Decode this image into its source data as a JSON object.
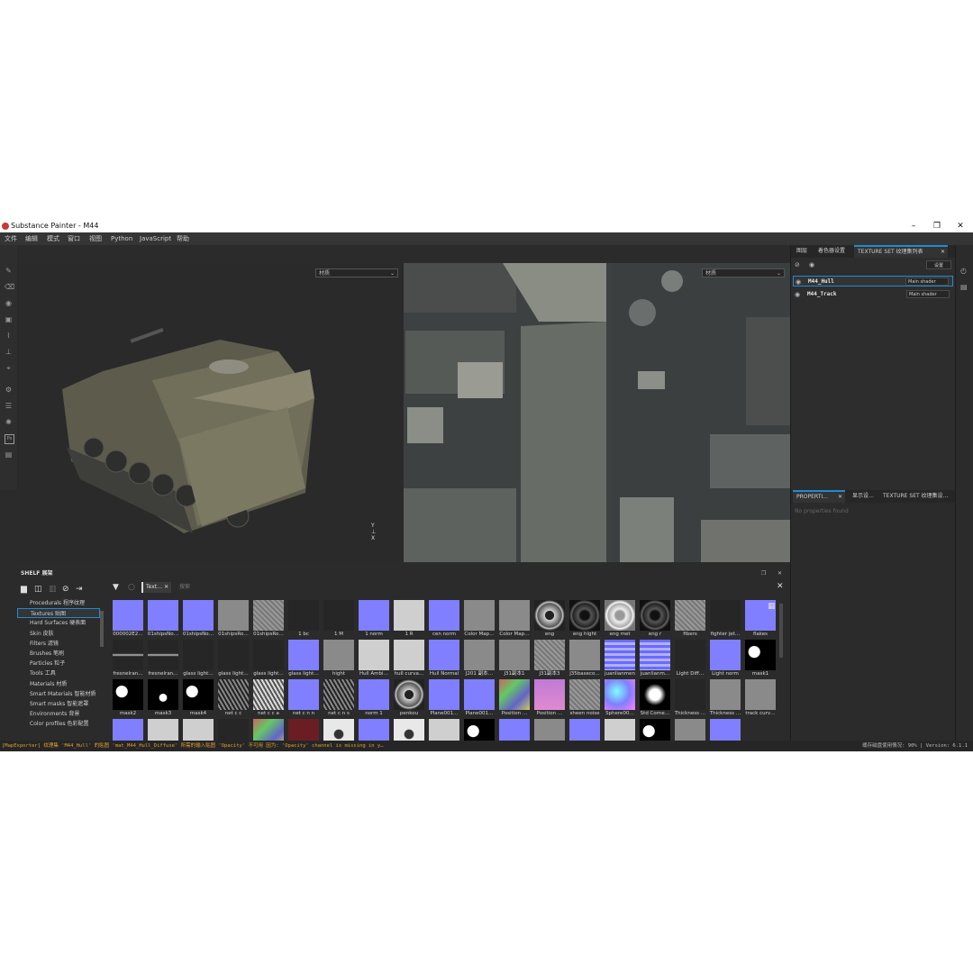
{
  "window": {
    "title": "Substance Painter - M44",
    "minimize": "–",
    "maximize": "❐",
    "close": "✕"
  },
  "menu": [
    "文件",
    "编辑",
    "模式",
    "窗口",
    "视图",
    "Python",
    "JavaScript",
    "帮助"
  ],
  "viewport3d": {
    "channel_select": "材质"
  },
  "viewport2d": {
    "channel_select": "材质"
  },
  "viewport_toolbar": {
    "mode_label": "D☰"
  },
  "right_panel": {
    "tabs": [
      "图层",
      "着色器设置",
      "TEXTURE SET 纹理集列表"
    ],
    "settings_button": "设置",
    "texture_sets": [
      {
        "name": "M44_Hull",
        "shader": "Main shader"
      },
      {
        "name": "M44_Track",
        "shader": "Main shader"
      }
    ]
  },
  "properties": {
    "tabs": [
      "PROPERTI…",
      "显示设…",
      "TEXTURE SET 纹理集设…"
    ],
    "empty_text": "No properties found"
  },
  "shelf": {
    "title": "SHELF 展架",
    "filter_chip": "Text…",
    "search_placeholder": "搜索",
    "categories": [
      "Procedurals 程序纹理",
      "Textures 贴图",
      "Hard Surfaces 硬表面",
      "Skin 皮肤",
      "Filters 滤镜",
      "Brushes 笔刷",
      "Particles 粒子",
      "Tools 工具",
      "Materials 材质",
      "Smart Materials 智能材质",
      "Smart masks 智能遮罩",
      "Environments 背景",
      "Color profiles 色彩配置"
    ],
    "selected_category": 1,
    "textures": [
      {
        "label": "000002E2…",
        "kind": "normal"
      },
      {
        "label": "01shipsNo…",
        "kind": "normal"
      },
      {
        "label": "01shipsNo…",
        "kind": "normal"
      },
      {
        "label": "01shipsRo…",
        "kind": "gray"
      },
      {
        "label": "01shipsRo…",
        "kind": "noise"
      },
      {
        "label": "1 bc",
        "kind": "dark"
      },
      {
        "label": "1 M",
        "kind": "dark"
      },
      {
        "label": "1 norm",
        "kind": "normal"
      },
      {
        "label": "1 R",
        "kind": "light"
      },
      {
        "label": "cen norm",
        "kind": "normal"
      },
      {
        "label": "Color Map…",
        "kind": "gray"
      },
      {
        "label": "Color Map…",
        "kind": "gray"
      },
      {
        "label": "eng",
        "kind": "ring"
      },
      {
        "label": "eng hight",
        "kind": "ringdark"
      },
      {
        "label": "eng met",
        "kind": "ringlight"
      },
      {
        "label": "eng r",
        "kind": "ringdark"
      },
      {
        "label": "fibers",
        "kind": "noise"
      },
      {
        "label": "fighter jet…",
        "kind": "dark"
      },
      {
        "label": "flakes",
        "kind": "normal"
      },
      {
        "label": "fresnelran…",
        "kind": "gradline"
      },
      {
        "label": "fresnelran…",
        "kind": "gradline"
      },
      {
        "label": "glass light…",
        "kind": "dark"
      },
      {
        "label": "glass light…",
        "kind": "dark"
      },
      {
        "label": "glass light…",
        "kind": "dark"
      },
      {
        "label": "glass light…",
        "kind": "normal"
      },
      {
        "label": "hight",
        "kind": "gray"
      },
      {
        "label": "Hull Ambi…",
        "kind": "light"
      },
      {
        "label": "hull curva…",
        "kind": "light"
      },
      {
        "label": "Hull Normal",
        "kind": "normal"
      },
      {
        "label": "J201 副本…",
        "kind": "gray"
      },
      {
        "label": "J31副本1",
        "kind": "gray"
      },
      {
        "label": "J31副本3",
        "kind": "noise"
      },
      {
        "label": "J35baseco…",
        "kind": "gray"
      },
      {
        "label": "juanlianmen",
        "kind": "stripes"
      },
      {
        "label": "juanlianm…",
        "kind": "stripes"
      },
      {
        "label": "Light Diff…",
        "kind": "dark"
      },
      {
        "label": "Light norm",
        "kind": "normal"
      },
      {
        "label": "mask1",
        "kind": "splat"
      },
      {
        "label": "mask2",
        "kind": "splat"
      },
      {
        "label": "mask3",
        "kind": "splatdark"
      },
      {
        "label": "mask4",
        "kind": "splat"
      },
      {
        "label": "net c c",
        "kind": "mesh"
      },
      {
        "label": "net c c a",
        "kind": "meshlight"
      },
      {
        "label": "net c n n",
        "kind": "normal"
      },
      {
        "label": "net c n s",
        "kind": "mesh"
      },
      {
        "label": "norm 1",
        "kind": "normal"
      },
      {
        "label": "penkou",
        "kind": "ring"
      },
      {
        "label": "Plane001…",
        "kind": "normal"
      },
      {
        "label": "Plane001…",
        "kind": "normal"
      },
      {
        "label": "Position …",
        "kind": "rainbow"
      },
      {
        "label": "Position …",
        "kind": "pink"
      },
      {
        "label": "sheen noise",
        "kind": "noise"
      },
      {
        "label": "Sphere00…",
        "kind": "sphere"
      },
      {
        "label": "Std Corne…",
        "kind": "blob"
      },
      {
        "label": "Thickness …",
        "kind": "dark"
      },
      {
        "label": "Thickness …",
        "kind": "gray"
      },
      {
        "label": "track curv…",
        "kind": "gray"
      },
      {
        "label": "",
        "kind": "normal"
      },
      {
        "label": "",
        "kind": "light"
      },
      {
        "label": "",
        "kind": "light"
      },
      {
        "label": "",
        "kind": "dark"
      },
      {
        "label": "",
        "kind": "rainbow"
      },
      {
        "label": "",
        "kind": "red"
      },
      {
        "label": "",
        "kind": "bird"
      },
      {
        "label": "",
        "kind": "normal"
      },
      {
        "label": "",
        "kind": "bird"
      },
      {
        "label": "",
        "kind": "light"
      },
      {
        "label": "",
        "kind": "splat"
      },
      {
        "label": "",
        "kind": "normal"
      },
      {
        "label": "",
        "kind": "gray"
      },
      {
        "label": "",
        "kind": "normal"
      },
      {
        "label": "",
        "kind": "light"
      },
      {
        "label": "",
        "kind": "splat"
      },
      {
        "label": "",
        "kind": "gray"
      },
      {
        "label": "",
        "kind": "normal"
      }
    ]
  },
  "status": {
    "log": "[MapExporter] 纹理集 'M44_Hull' 的贴图 'mat_M44_Hull_Diffuse' 所需的输入贴图 'Opacity' 不可用 因为: 'Opacity' channel is missing in y…",
    "memory": "缓存磁盘使用情况: 90% | Version: 6.1.1"
  },
  "colors": {
    "accent": "#1f8ad1",
    "normal_map": "#7f7fff",
    "warning": "#e0a030"
  }
}
